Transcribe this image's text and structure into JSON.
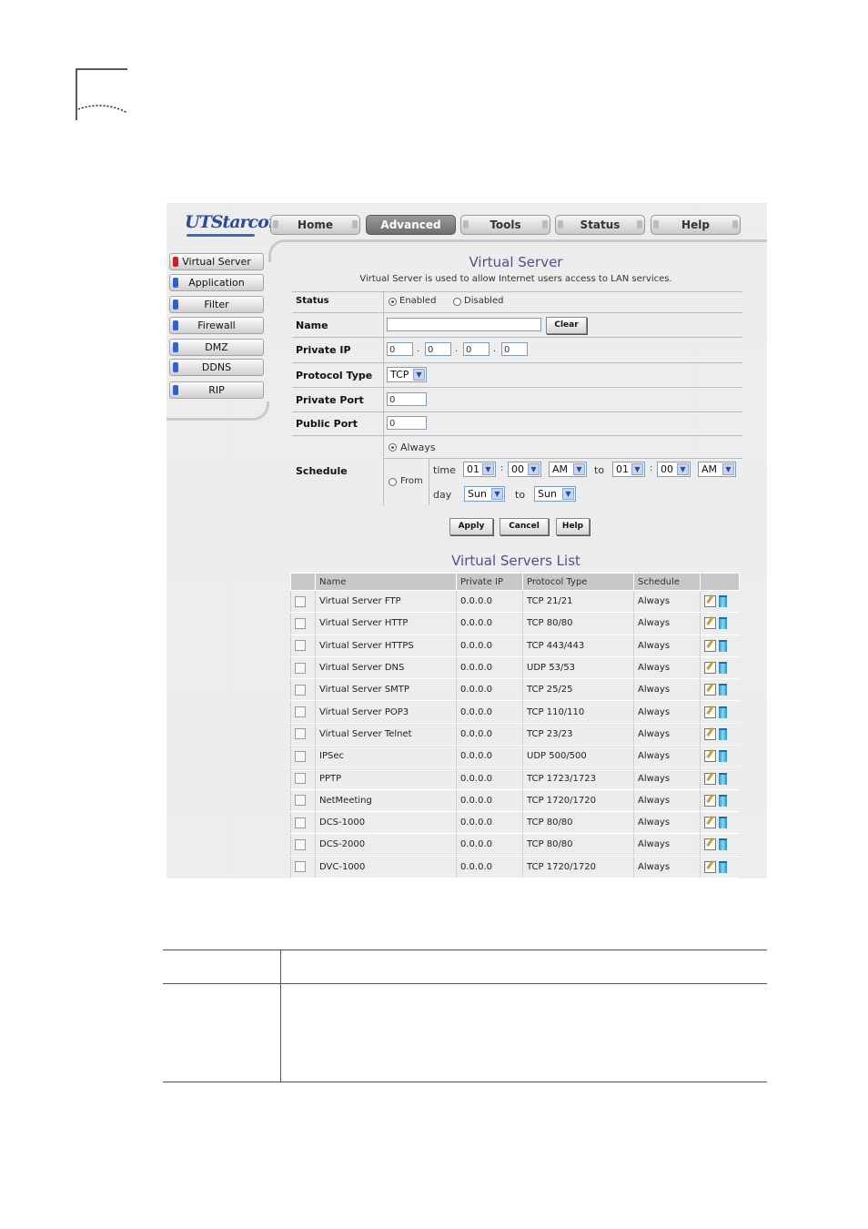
{
  "header": {
    "logo": "UTStarcom",
    "tabs": [
      "Home",
      "Advanced",
      "Tools",
      "Status",
      "Help"
    ],
    "active_tab": "Advanced"
  },
  "sidebar": {
    "items": [
      "Virtual Server",
      "Application",
      "Filter",
      "Firewall",
      "DMZ",
      "DDNS",
      "RIP"
    ],
    "active": "Virtual Server"
  },
  "form": {
    "title": "Virtual Server",
    "subtitle": "Virtual Server is used to allow Internet users access to LAN services.",
    "status_label": "Status",
    "status_enabled": "Enabled",
    "status_disabled": "Disabled",
    "name_label": "Name",
    "name_value": "",
    "clear_button": "Clear",
    "private_ip_label": "Private IP",
    "private_ip": [
      "0",
      "0",
      "0",
      "0"
    ],
    "dot": ".",
    "protocol_label": "Protocol Type",
    "protocol_value": "TCP",
    "private_port_label": "Private Port",
    "private_port_value": "0",
    "public_port_label": "Public Port",
    "public_port_value": "0",
    "schedule_label": "Schedule",
    "schedule_always": "Always",
    "schedule_from": "From",
    "time_label": "time",
    "day_label": "day",
    "to_label": "to",
    "colon": ":",
    "time_from_hour": "01",
    "time_from_min": "00",
    "time_from_ampm": "AM",
    "time_to_hour": "01",
    "time_to_min": "00",
    "time_to_ampm": "AM",
    "day_from": "Sun",
    "day_to": "Sun",
    "apply_button": "Apply",
    "cancel_button": "Cancel",
    "help_button": "Help"
  },
  "list": {
    "title": "Virtual Servers List",
    "columns": [
      "Name",
      "Private IP",
      "Protocol Type",
      "Schedule"
    ],
    "rows": [
      {
        "name": "Virtual Server FTP",
        "ip": "0.0.0.0",
        "proto": "TCP  21/21",
        "schedule": "Always"
      },
      {
        "name": "Virtual Server HTTP",
        "ip": "0.0.0.0",
        "proto": "TCP  80/80",
        "schedule": "Always"
      },
      {
        "name": "Virtual Server HTTPS",
        "ip": "0.0.0.0",
        "proto": "TCP  443/443",
        "schedule": "Always"
      },
      {
        "name": "Virtual Server DNS",
        "ip": "0.0.0.0",
        "proto": "UDP  53/53",
        "schedule": "Always"
      },
      {
        "name": "Virtual Server SMTP",
        "ip": "0.0.0.0",
        "proto": "TCP  25/25",
        "schedule": "Always"
      },
      {
        "name": "Virtual Server POP3",
        "ip": "0.0.0.0",
        "proto": "TCP  110/110",
        "schedule": "Always"
      },
      {
        "name": "Virtual Server Telnet",
        "ip": "0.0.0.0",
        "proto": "TCP  23/23",
        "schedule": "Always"
      },
      {
        "name": "IPSec",
        "ip": "0.0.0.0",
        "proto": "UDP  500/500",
        "schedule": "Always"
      },
      {
        "name": "PPTP",
        "ip": "0.0.0.0",
        "proto": "TCP  1723/1723",
        "schedule": "Always"
      },
      {
        "name": "NetMeeting",
        "ip": "0.0.0.0",
        "proto": "TCP  1720/1720",
        "schedule": "Always"
      },
      {
        "name": "DCS-1000",
        "ip": "0.0.0.0",
        "proto": "TCP  80/80",
        "schedule": "Always"
      },
      {
        "name": "DCS-2000",
        "ip": "0.0.0.0",
        "proto": "TCP  80/80",
        "schedule": "Always"
      },
      {
        "name": "DVC-1000",
        "ip": "0.0.0.0",
        "proto": "TCP  1720/1720",
        "schedule": "Always"
      }
    ]
  }
}
